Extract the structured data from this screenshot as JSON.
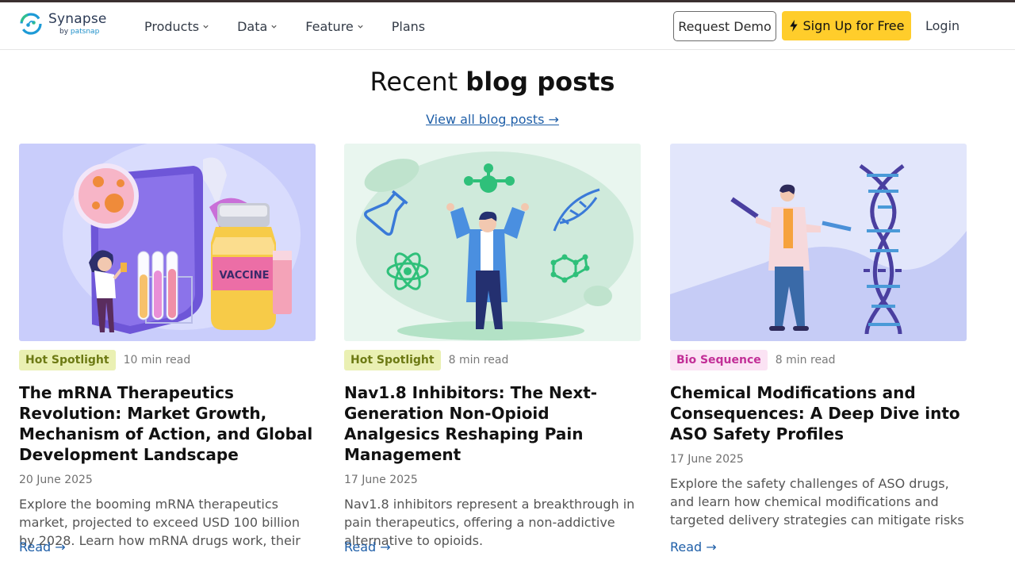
{
  "brand": {
    "name": "Synapse",
    "sub_prefix": "by ",
    "sub_brand": "patsnap",
    "accent": "#1d8fc9"
  },
  "nav": {
    "items": [
      {
        "label": "Products",
        "has_dropdown": true
      },
      {
        "label": "Data",
        "has_dropdown": true
      },
      {
        "label": "Feature",
        "has_dropdown": true
      },
      {
        "label": "Plans",
        "has_dropdown": false
      }
    ],
    "request_demo": "Request Demo",
    "signup": "Sign Up for Free",
    "signup_icon": "bolt-icon",
    "signup_color": "#ffcd2b",
    "login": "Login"
  },
  "section": {
    "title_light": "Recent ",
    "title_bold": "blog posts",
    "view_all": "View all blog posts →"
  },
  "posts": [
    {
      "tag": "Hot Spotlight",
      "tag_style": "hot",
      "read_time": "10 min read",
      "title": "The mRNA Therapeutics Revolution: Market Growth, Mechanism of Action, and Global Development Landscape",
      "date": "20 June 2025",
      "excerpt": "Explore the booming mRNA therapeutics market, projected to exceed USD 100 billion by 2028. Learn how mRNA drugs work, their key advantages, and...",
      "read_label": "Read →",
      "image_label": "VACCINE"
    },
    {
      "tag": "Hot Spotlight",
      "tag_style": "hot",
      "read_time": "8 min read",
      "title": "Nav1.8 Inhibitors: The Next-Generation Non-Opioid Analgesics Reshaping Pain Management",
      "date": "17 June 2025",
      "excerpt": "Nav1.8 inhibitors represent a breakthrough in pain therapeutics, offering a non-addictive alternative to opioids.",
      "read_label": "Read →"
    },
    {
      "tag": "Bio Sequence",
      "tag_style": "bio",
      "read_time": "8 min read",
      "title": "Chemical Modifications and Consequences: A Deep Dive into ASO Safety Profiles",
      "date": "17 June 2025",
      "excerpt": "Explore the safety challenges of ASO drugs, and learn how chemical modifications and targeted delivery strategies can mitigate risks while...",
      "read_label": "Read →"
    }
  ],
  "colors": {
    "tag_hot_bg": "#eaf0b3",
    "tag_hot_text": "#6d7a14",
    "tag_bio_bg": "#fbe3f4",
    "tag_bio_text": "#c22f97",
    "link": "#1f5fa8"
  }
}
